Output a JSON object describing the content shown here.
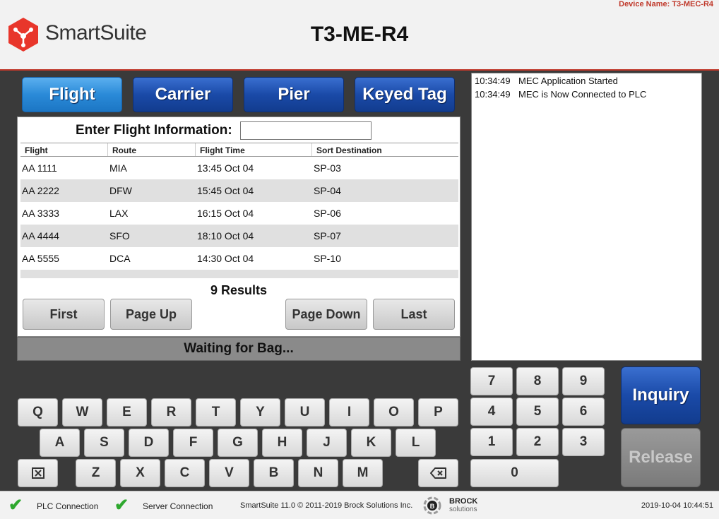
{
  "header": {
    "brand": "SmartSuite",
    "title": "T3-ME-R4",
    "device_name": "Device Name: T3-MEC-R4"
  },
  "tabs": [
    {
      "label": "Flight",
      "active": true
    },
    {
      "label": "Carrier",
      "active": false
    },
    {
      "label": "Pier",
      "active": false
    },
    {
      "label": "Keyed Tag",
      "active": false
    }
  ],
  "flight": {
    "enter_label": "Enter Flight Information:",
    "input_value": "",
    "columns": [
      "Flight",
      "Route",
      "Flight Time",
      "Sort Destination"
    ],
    "rows": [
      [
        "AA 1111",
        "MIA",
        "13:45 Oct 04",
        "SP-03"
      ],
      [
        "AA 2222",
        "DFW",
        "15:45 Oct 04",
        "SP-04"
      ],
      [
        "AA 3333",
        "LAX",
        "16:15 Oct 04",
        "SP-06"
      ],
      [
        "AA 4444",
        "SFO",
        "18:10 Oct 04",
        "SP-07"
      ],
      [
        "AA 5555",
        "DCA",
        "14:30 Oct 04",
        "SP-10"
      ]
    ],
    "results": "9 Results",
    "buttons": {
      "first": "First",
      "page_up": "Page Up",
      "page_down": "Page Down",
      "last": "Last"
    }
  },
  "status": "Waiting for Bag...",
  "log": [
    {
      "time": "10:34:49",
      "message": "MEC Application Started"
    },
    {
      "time": "10:34:49",
      "message": "MEC is Now Connected to PLC"
    }
  ],
  "keyboard": {
    "row1": [
      "Q",
      "W",
      "E",
      "R",
      "T",
      "Y",
      "U",
      "I",
      "O",
      "P"
    ],
    "row2": [
      "A",
      "S",
      "D",
      "F",
      "G",
      "H",
      "J",
      "K",
      "L"
    ],
    "row3": [
      "Z",
      "X",
      "C",
      "V",
      "B",
      "N",
      "M"
    ],
    "clear_icon": "clear-box-icon",
    "backspace_icon": "backspace-icon"
  },
  "numpad": [
    "7",
    "8",
    "9",
    "4",
    "5",
    "6",
    "1",
    "2",
    "3",
    "0"
  ],
  "actions": {
    "inquiry": "Inquiry",
    "release": "Release",
    "release_enabled": false
  },
  "footer": {
    "plc": "PLC Connection",
    "server": "Server Connection",
    "copyright": "SmartSuite 11.0 © 2011-2019 Brock Solutions Inc.",
    "brock_top": "BROCK",
    "brock_bottom": "solutions",
    "datetime": "2019-10-04 10:44:51"
  },
  "colors": {
    "accent": "#c0392b",
    "tab_blue": "#1a4aa8",
    "tab_active": "#2a8ad8",
    "ok_green": "#2ea82e"
  }
}
